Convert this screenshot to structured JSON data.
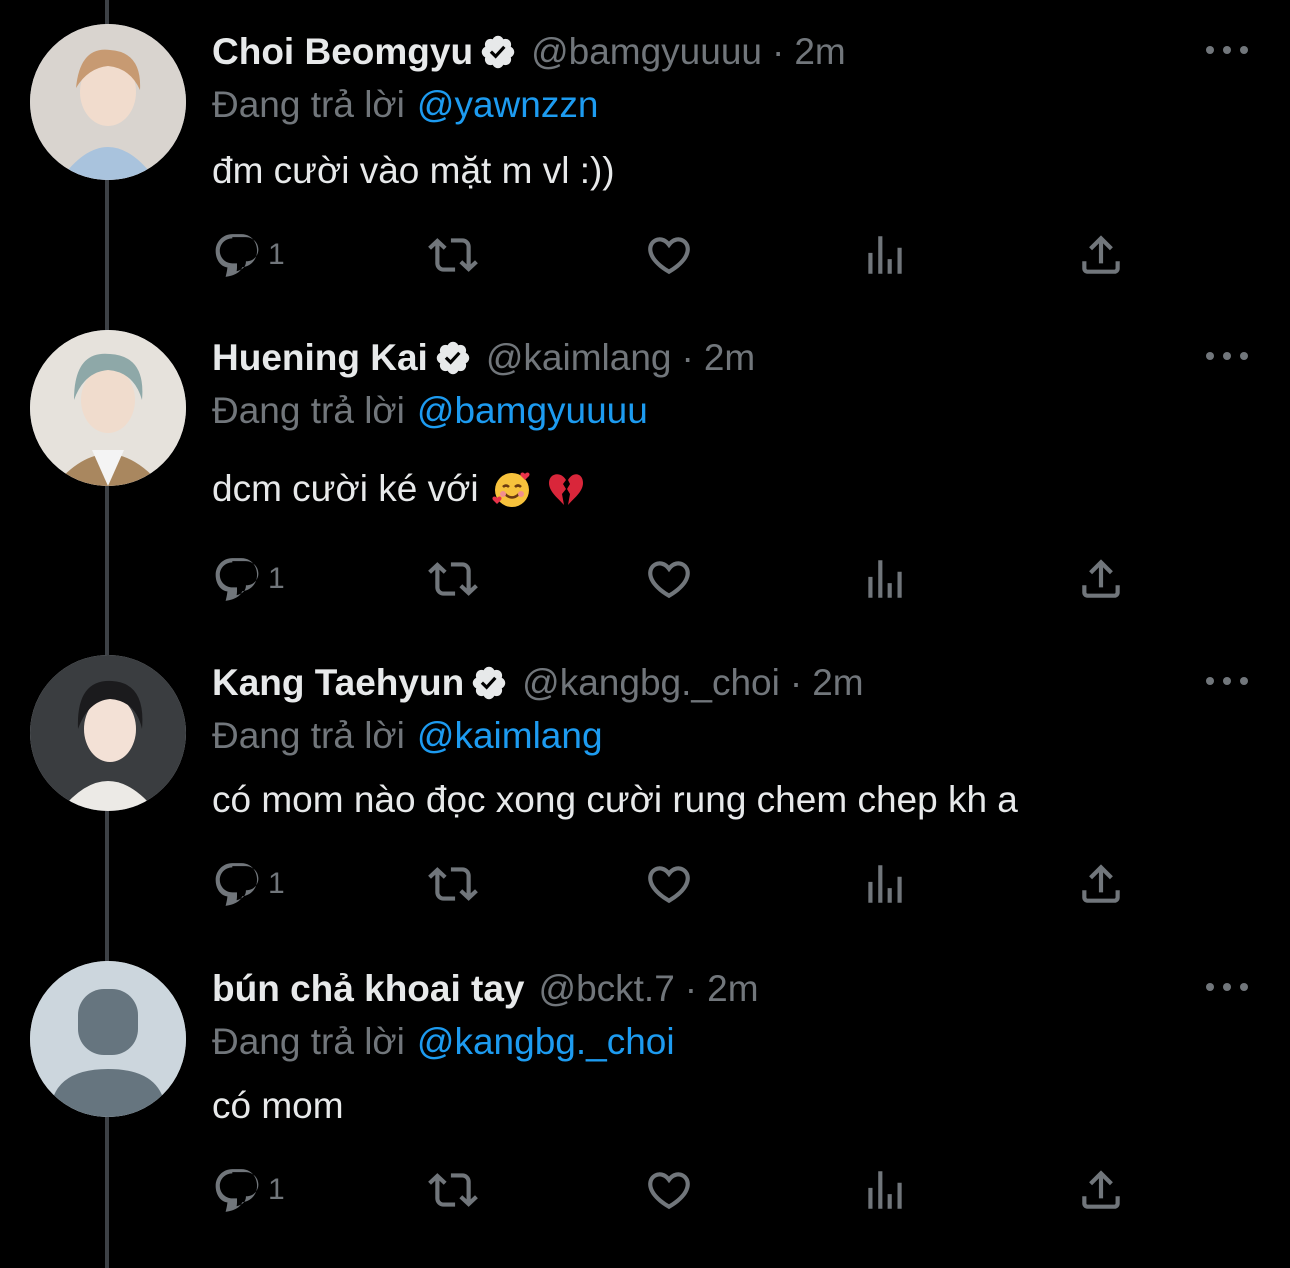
{
  "reply_prefix": "Đang trả lời",
  "colors": {
    "background": "#000000",
    "text": "#e7e9ea",
    "muted": "#71767b",
    "accent": "#1d9bf0",
    "thread_line": "#3d4146"
  },
  "tweets": [
    {
      "name": "Choi Beomgyu",
      "verified": true,
      "handle": "@bamgyuuuu",
      "dot": "·",
      "time": "2m",
      "reply_to": "@yawnzzn",
      "text": "đm cười vào mặt m vl :))",
      "emoji": [],
      "reply_count": "1",
      "avatar": "photo-avatar"
    },
    {
      "name": "Huening Kai",
      "verified": true,
      "handle": "@kaimlang",
      "dot": "·",
      "time": "2m",
      "reply_to": "@bamgyuuuu",
      "text": "dcm cười ké với",
      "emoji": [
        "smiling-face-with-hearts-emoji",
        "broken-heart-emoji"
      ],
      "reply_count": "1",
      "avatar": "photo-avatar"
    },
    {
      "name": "Kang Taehyun",
      "verified": true,
      "handle": "@kangbg._choi",
      "dot": "·",
      "time": "2m",
      "reply_to": "@kaimlang",
      "text": "có mom nào đọc xong cười rung chem chep kh a",
      "emoji": [],
      "reply_count": "1",
      "avatar": "photo-avatar"
    },
    {
      "name": "bún chả khoai tay",
      "verified": false,
      "handle": "@bckt.7",
      "dot": "·",
      "time": "2m",
      "reply_to": "@kangbg._choi",
      "text": "có mom",
      "emoji": [],
      "reply_count": "1",
      "avatar": "default-avatar"
    }
  ],
  "icons": [
    "reply-icon",
    "retweet-icon",
    "like-icon",
    "stats-icon",
    "share-icon",
    "more-icon",
    "verified-badge-icon"
  ]
}
